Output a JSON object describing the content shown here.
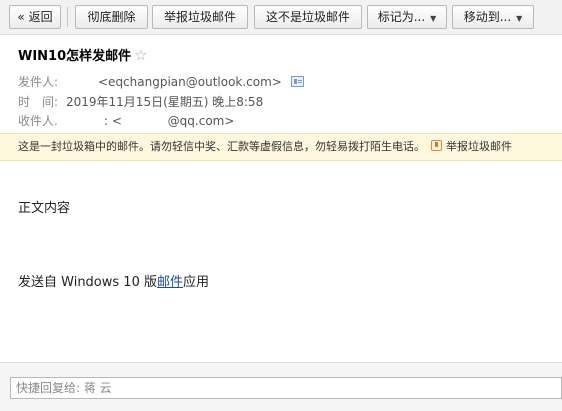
{
  "toolbar": {
    "back_label": "« 返回",
    "delete_permanent_label": "彻底删除",
    "report_spam_label": "举报垃圾邮件",
    "not_spam_label": "这不是垃圾邮件",
    "mark_as_label": "标记为...",
    "move_to_label": "移动到..."
  },
  "header": {
    "subject": "WIN10怎样发邮件",
    "sender_label": "发件人:",
    "sender_value": "<eqchangpian@outlook.com>",
    "time_label": "时　间:",
    "time_value": "2019年11月15日(星期五) 晚上8:58",
    "recipient_label": "收件人.",
    "recipient_value": ": <            @qq.com>"
  },
  "warning": {
    "text": "这是一封垃圾箱中的邮件。请勿轻信中奖、汇款等虚假信息，勿轻易拨打陌生电话。",
    "report_label": "举报垃圾邮件"
  },
  "body": {
    "line1": "正文内容",
    "line2_prefix": "发送自 Windows 10 版",
    "line2_link": "邮件",
    "line2_suffix": "应用"
  },
  "quick_reply": {
    "placeholder": "快捷回复给: 蒋 云"
  },
  "icons": {
    "star": "star-outline-icon",
    "address_book": "address-card-icon",
    "report": "report-flag-icon",
    "dropdown": "caret-down-icon"
  }
}
